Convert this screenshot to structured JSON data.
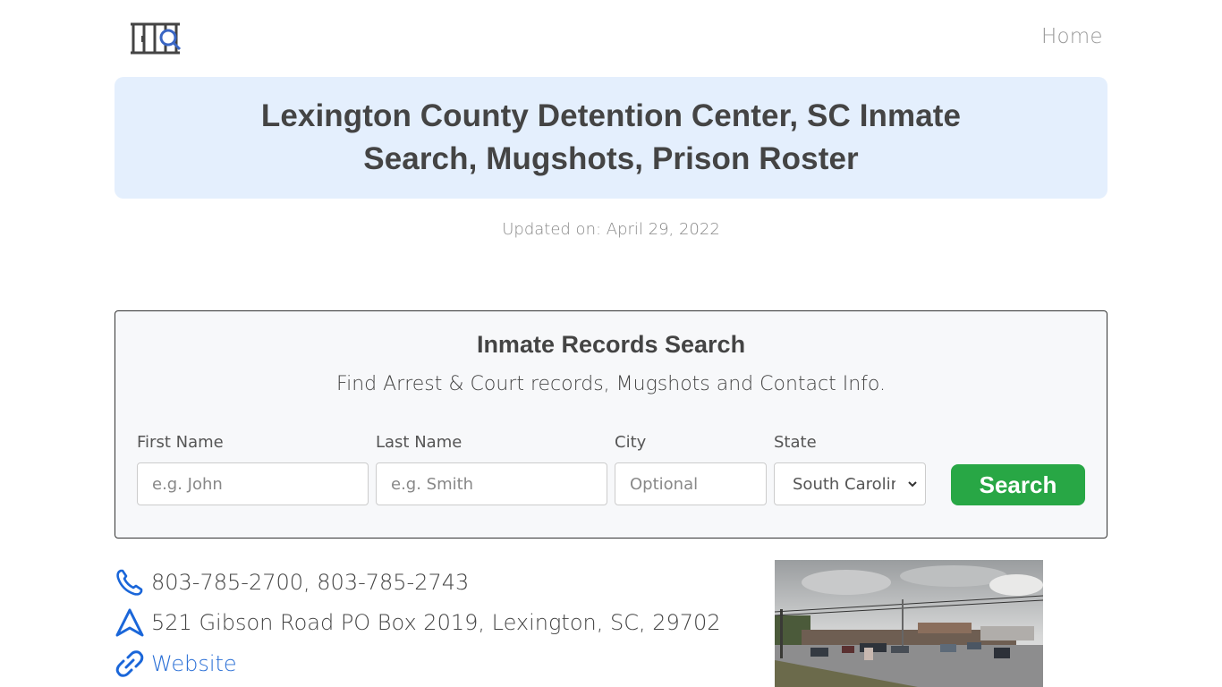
{
  "header": {
    "logo_icon": "jail-bars-search-icon",
    "nav": {
      "home_label": "Home"
    }
  },
  "hero": {
    "title": "Lexington County Detention Center, SC Inmate Search, Mugshots, Prison Roster"
  },
  "updated": "Updated on: April 29, 2022",
  "search": {
    "title": "Inmate Records Search",
    "subtitle": "Find Arrest & Court records, Mugshots and Contact Info.",
    "fields": {
      "first_name": {
        "label": "First Name",
        "placeholder": "e.g. John",
        "value": ""
      },
      "last_name": {
        "label": "Last Name",
        "placeholder": "e.g. Smith",
        "value": ""
      },
      "city": {
        "label": "City",
        "placeholder": "Optional",
        "value": ""
      },
      "state": {
        "label": "State",
        "selected": "South Carolina",
        "display": "South Carolir"
      }
    },
    "button_label": "Search",
    "button_color": "#28a745"
  },
  "contact": {
    "phone": "803-785-2700, 803-785-2743",
    "address": "521 Gibson Road PO Box 2019, Lexington, SC, 29702",
    "website_label": "Website",
    "icon_color": "#1a66d9"
  },
  "photo": {
    "alt": "Street view of Lexington County Detention Center"
  }
}
